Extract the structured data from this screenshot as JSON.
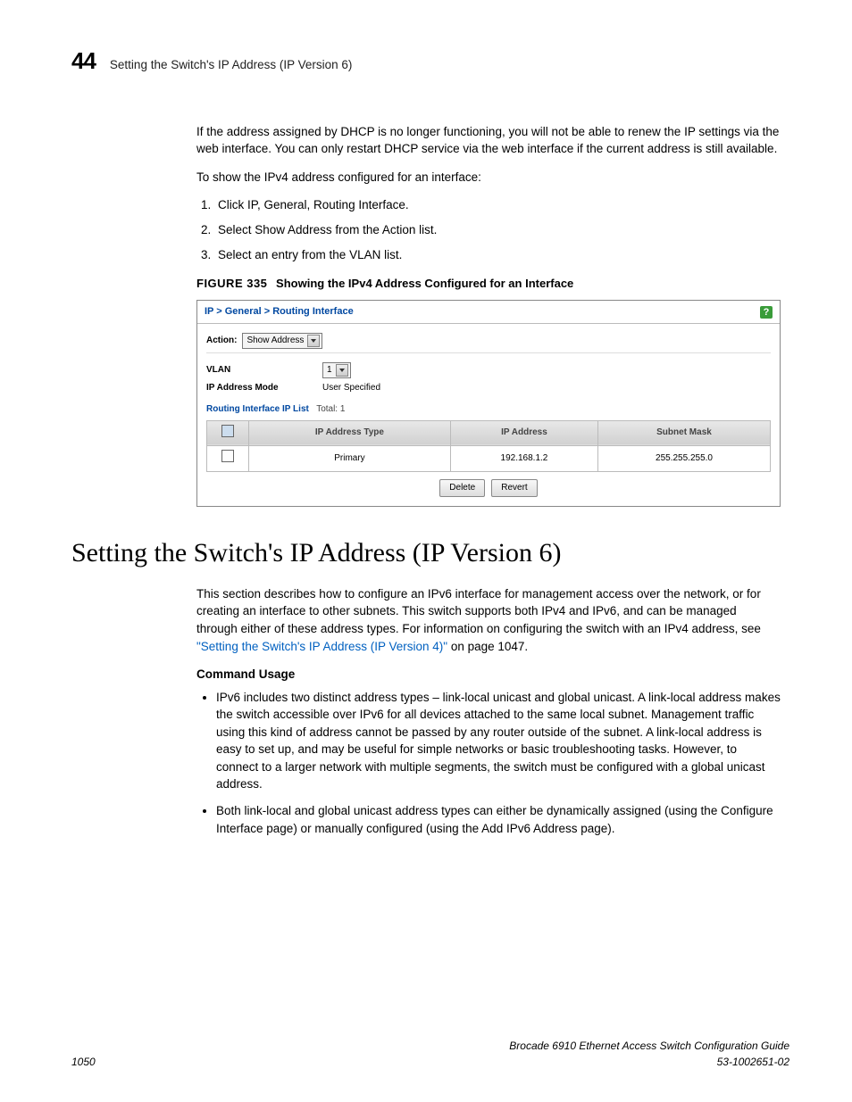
{
  "header": {
    "chapter_number": "44",
    "chapter_title": "Setting the Switch's IP Address (IP Version 6)"
  },
  "intro": {
    "p1": "If the address assigned by DHCP is no longer functioning, you will not be able to renew the IP settings via the web interface. You can only restart DHCP service via the web interface if the current address is still available.",
    "p2": "To show the IPv4 address configured for an interface:",
    "steps": [
      "Click IP, General, Routing Interface.",
      "Select Show Address from the Action list.",
      "Select an entry from the VLAN list."
    ]
  },
  "figure": {
    "label": "FIGURE 335",
    "caption": "Showing the IPv4 Address Configured for an Interface"
  },
  "screenshot": {
    "breadcrumb": "IP > General > Routing Interface",
    "action_label": "Action:",
    "action_value": "Show Address",
    "vlan_label": "VLAN",
    "vlan_value": "1",
    "mode_label": "IP Address Mode",
    "mode_value": "User Specified",
    "list_title": "Routing Interface IP List",
    "list_total_label": "Total:",
    "list_total_value": "1",
    "columns": {
      "c1": "IP Address Type",
      "c2": "IP Address",
      "c3": "Subnet Mask"
    },
    "row": {
      "type": "Primary",
      "ip": "192.168.1.2",
      "mask": "255.255.255.0"
    },
    "buttons": {
      "delete": "Delete",
      "revert": "Revert"
    }
  },
  "section": {
    "title": "Setting the Switch's IP Address (IP Version 6)",
    "p1a": "This section describes how to configure an IPv6 interface for management access over the network, or for creating an interface to other subnets. This switch supports both IPv4 and IPv6, and can be managed through either of these address types. For information on configuring the switch with an IPv4 address, see ",
    "p1_link": "\"Setting the Switch's IP Address (IP Version 4)\"",
    "p1b": " on page 1047.",
    "cmd_usage_label": "Command Usage",
    "bullets": [
      "IPv6 includes two distinct address types – link-local unicast and global unicast. A link-local address makes the switch accessible over IPv6 for all devices attached to the same local subnet. Management traffic using this kind of address cannot be passed by any router outside of the subnet. A link-local address is easy to set up, and may be useful for simple networks or basic troubleshooting tasks. However, to connect to a larger network with multiple segments, the switch must be configured with a global unicast address.",
      "Both link-local and global unicast address types can either be dynamically assigned (using the Configure Interface page) or manually configured (using the Add IPv6 Address page)."
    ]
  },
  "footer": {
    "page_number": "1050",
    "doc_title": "Brocade 6910 Ethernet Access Switch Configuration Guide",
    "doc_id": "53-1002651-02"
  }
}
